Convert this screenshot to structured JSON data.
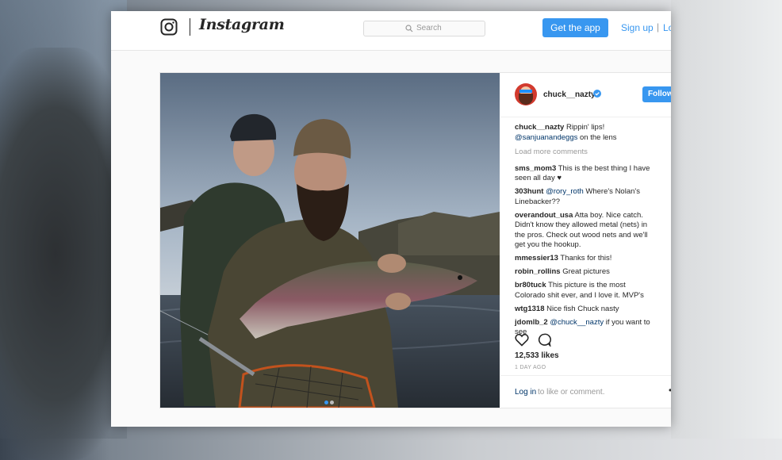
{
  "header": {
    "wordmark": "Instagram",
    "search_placeholder": "Search",
    "get_app": "Get the app",
    "sign_up": "Sign up",
    "separator": "|",
    "log_in": "Lo"
  },
  "post": {
    "username": "chuck__nazty",
    "follow_label": "Follow",
    "caption": {
      "user": "chuck__nazty",
      "text": "Rippin' lips!",
      "mention": "@sanjuanandeggs",
      "rest": "on the lens"
    },
    "load_more": "Load more comments",
    "comments": [
      {
        "user": "sms_mom3",
        "text": "This is the best thing I have seen all day ♥"
      },
      {
        "user": "303hunt",
        "mention": "@rory_roth",
        "text": "Where's Nolan's Linebacker??"
      },
      {
        "user": "overandout_usa",
        "text": "Atta boy. Nice catch. Didn't know they allowed metal (nets) in the pros. Check out wood nets and we'll get you the hookup."
      },
      {
        "user": "mmessier13",
        "text": "Thanks for this!"
      },
      {
        "user": "robin_rollins",
        "text": "Great pictures"
      },
      {
        "user": "br80tuck",
        "text": "This picture is the most Colorado shit ever, and I love it. MVP's"
      },
      {
        "user": "wtg1318",
        "text": "Nice fish Chuck nasty"
      },
      {
        "user": "jdomlb_2",
        "mention": "@chuck__nazty",
        "text": "if you want to see"
      }
    ],
    "likes": "12,533 likes",
    "time": "1 DAY AGO",
    "footer_login": "Log in",
    "footer_rest": "to like or comment.",
    "footer_more": "••"
  },
  "colors": {
    "accent": "#3897f0",
    "link": "#003569",
    "muted": "#999999"
  }
}
